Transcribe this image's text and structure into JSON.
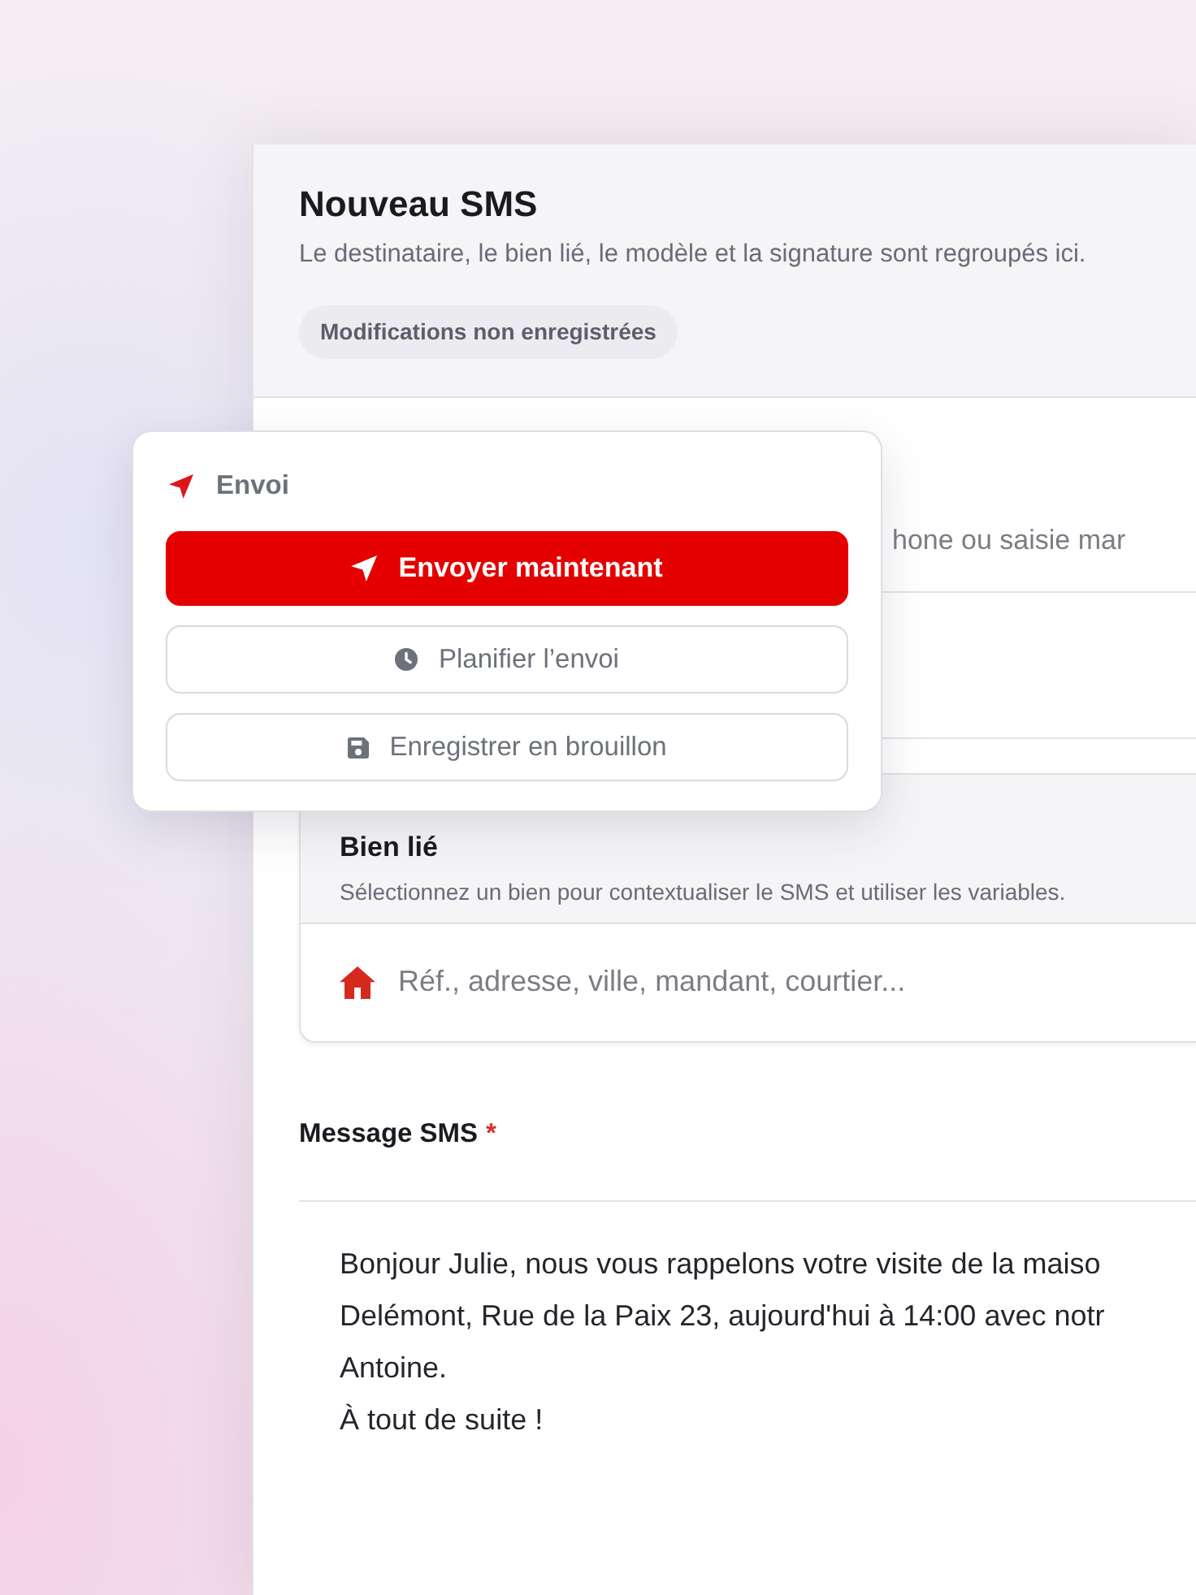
{
  "panel": {
    "title": "Nouveau SMS",
    "subtitle": "Le destinataire, le bien lié, le modèle et la signature sont regroupés ici.",
    "status_badge": "Modifications non enregistrées"
  },
  "send_popover": {
    "title": "Envoi",
    "actions": [
      {
        "kind": "send",
        "label": "Envoyer maintenant"
      },
      {
        "kind": "schedule",
        "label": "Planifier l’envoi"
      },
      {
        "kind": "draft",
        "label": "Enregistrer en brouillon"
      }
    ]
  },
  "recipient_field": {
    "placeholder": "hone ou saisie mar"
  },
  "linked_property": {
    "title": "Bien lié",
    "description": "Sélectionnez un bien pour contextualiser le SMS et utiliser les variables.",
    "search": {
      "placeholder": "Réf., adresse, ville, mandant, courtier..."
    }
  },
  "message": {
    "label": "Message SMS",
    "required_mark": "*",
    "value": "Bonjour Julie, nous vous rappelons votre visite de la maiso\nDelémont, Rue de la Paix 23, aujourd'hui à 14:00 avec notr\nAntoine.\nÀ tout de suite !"
  }
}
